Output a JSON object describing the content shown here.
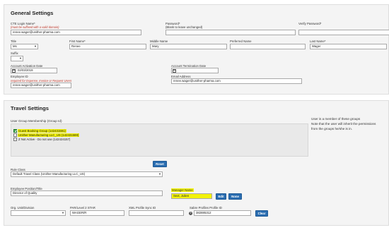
{
  "general": {
    "title": "General Settings",
    "login_label": "CTE Login Name*",
    "login_hint": "(must be suffixed with a valid domain)",
    "login_value": "renee.wager@unither-pharma.com",
    "password_label": "Password*",
    "password_hint": "(Blank to leave unchanged)",
    "verify_label": "Verify Password*",
    "title_label": "Title",
    "title_value": "Ms",
    "first_label": "First Name*",
    "first_value": "Renee",
    "middle_label": "Middle Name",
    "middle_value": "Mary",
    "preferred_label": "Preferred Name",
    "last_label": "Last Name*",
    "last_value": "Wager",
    "suffix_label": "Suffix",
    "activation_label": "Account Activation Date",
    "activation_value": "02/03/2019",
    "termination_label": "Account Termination Date",
    "employee_label": "Employee ID",
    "employee_hint": "required for Expense, Invoice or Request Users",
    "employee_value": "renee.wager@unither-pharma.com",
    "email_label": "Email Address",
    "email_value": "renee.wager@unither-pharma.com"
  },
  "travel": {
    "title": "Travel Settings",
    "group_label": "User Group Membership (Group Id)",
    "groups": [
      {
        "label": "Guest Booking Group (142431591)",
        "checked": true,
        "highlight": true
      },
      {
        "label": "Unither Manufacturing LLC_US (142431588)",
        "checked": false,
        "highlight": true
      },
      {
        "label": "Z Not Active - Do not use (142424157)",
        "checked": false,
        "highlight": false
      }
    ],
    "note_line1": "User is a member of these groups",
    "note_line2": "Note that the user will inherit the permissions",
    "note_line3": "from the groups he/she is in.",
    "reset_label": "Reset",
    "rule_label": "Rule Class",
    "rule_value": "Default Travel Class (Unither Manufacturing LLC_US)",
    "position_label": "Employee Position/Title",
    "position_value": "Director of Quality",
    "manager_label": "Manager Name",
    "manager_value": "Sext, Julien",
    "edit_label": "Edit",
    "none_label": "None",
    "org_label": "Org. Unit/Division",
    "par_label": "PAR/Level 2 STAR",
    "par_value": "WAGER/R",
    "xml_label": "XML Profile Sync ID",
    "sabre_label": "Sabre Profiles Profile ID",
    "sabre_value": "382885312",
    "help_glyph": "?",
    "clear_label": "Clear"
  },
  "icons": {
    "dropdown": "▾",
    "calendar": "calendar-icon"
  },
  "colors": {
    "button": "#2a6db0",
    "highlight": "#f2f20a",
    "checked": "#2a9d3a"
  }
}
